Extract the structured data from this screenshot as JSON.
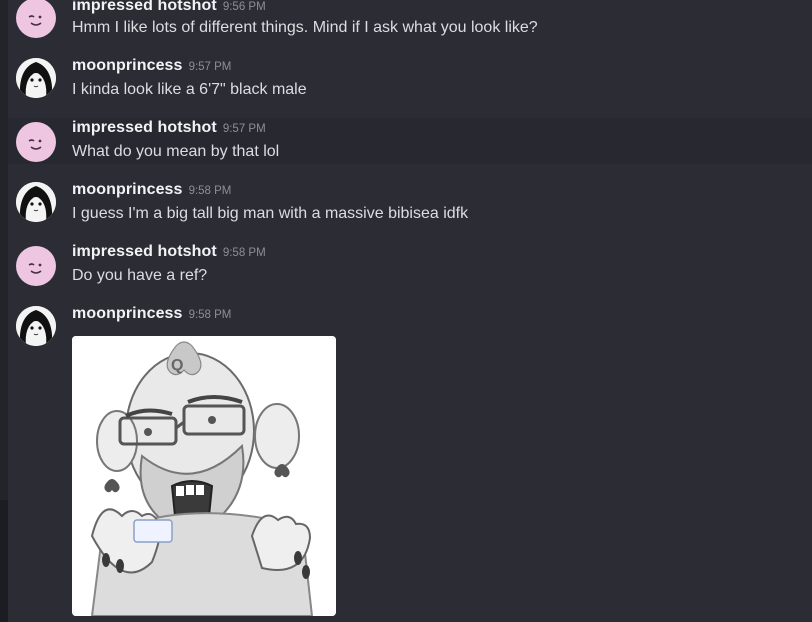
{
  "messages": [
    {
      "username": "impressed hotshot",
      "time": "9:56 PM",
      "text": "Hmm I like lots of different things. Mind if I ask what you look like?"
    },
    {
      "username": "moonprincess",
      "time": "9:57 PM",
      "text": "I kinda look like a 6'7\" black male"
    },
    {
      "username": "impressed hotshot",
      "time": "9:57 PM",
      "text": "What do you mean by that lol"
    },
    {
      "username": "moonprincess",
      "time": "9:58 PM",
      "text": "I guess I'm a big tall big man with a massive bibisea idfk"
    },
    {
      "username": "impressed hotshot",
      "time": "9:58 PM",
      "text": "Do you have a ref?"
    },
    {
      "username": "moonprincess",
      "time": "9:58 PM",
      "text": ""
    }
  ],
  "attachment": {
    "kind": "image",
    "letter": "Q"
  },
  "colors": {
    "background": "#2c2d34",
    "hover_row": "#282930",
    "username": "#f2f3f5",
    "text": "#dcdde1",
    "timestamp": "#8d8f96",
    "avatar_pink": "#efc6e2"
  }
}
